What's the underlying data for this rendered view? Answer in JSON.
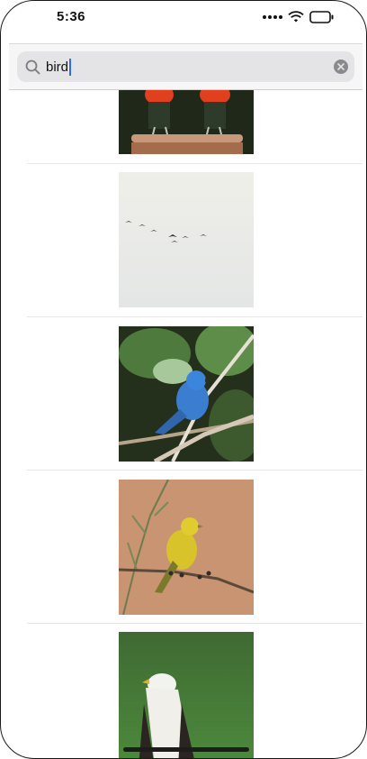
{
  "status_bar": {
    "time": "5:36",
    "icons": [
      "signal-icon",
      "wifi-icon",
      "battery-icon"
    ]
  },
  "search": {
    "value": "bird",
    "icon": "search-icon",
    "clear_icon": "clear-icon"
  },
  "results": [
    {
      "icon": "parrots-on-perch-thumbnail"
    },
    {
      "icon": "flock-of-birds-in-sky-thumbnail"
    },
    {
      "icon": "blue-bird-on-branch-thumbnail"
    },
    {
      "icon": "yellow-bird-on-branch-thumbnail"
    },
    {
      "icon": "eagle-on-grass-thumbnail"
    }
  ],
  "colors": {
    "search_bg": "#e4e4e6",
    "caret": "#2f6ee0",
    "divider": "#e6e6e6"
  }
}
